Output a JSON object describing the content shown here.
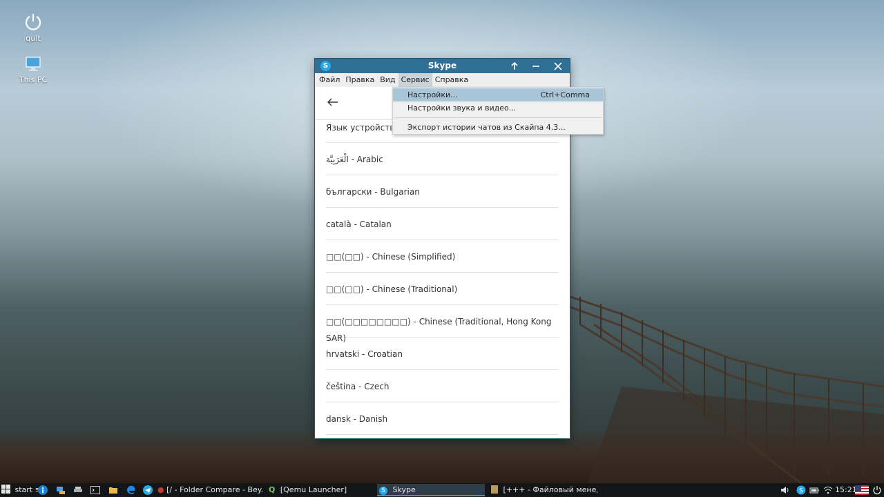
{
  "desktop": {
    "icons": [
      {
        "label": "quit",
        "icon": "power-icon"
      },
      {
        "label": "This PC",
        "icon": "computer-icon"
      }
    ]
  },
  "window": {
    "title": "Skype",
    "menu": [
      "Файл",
      "Правка",
      "Вид",
      "Сервис",
      "Справка"
    ],
    "active_menu": "Сервис",
    "list_header": "Язык устройства",
    "languages": [
      "الْعَرَبِيَّة - Arabic",
      "български - Bulgarian",
      "català - Catalan",
      "□□(□□) - Chinese (Simplified)",
      "□□(□□) - Chinese (Traditional)",
      "□□(□□□□□□□□) - Chinese (Traditional, Hong Kong SAR)",
      "hrvatski - Croatian",
      "čeština - Czech",
      "dansk - Danish"
    ]
  },
  "dropdown": {
    "items": [
      {
        "label": "Настройки...",
        "shortcut": "Ctrl+Comma",
        "highlighted": true
      },
      {
        "label": "Настройки звука и видео...",
        "shortcut": ""
      },
      {
        "label": "Экспорт истории чатов из Скайпа 4.3...",
        "shortcut": ""
      }
    ]
  },
  "taskbar": {
    "start_label": "start",
    "tasks": [
      {
        "label": "[/ - Folder Compare - Bey...",
        "icon": "beyond-compare-icon"
      },
      {
        "label": "[Qemu Launcher]",
        "icon": "qemu-icon"
      },
      {
        "label": "Skype",
        "icon": "skype-icon",
        "active": true
      },
      {
        "label": "[+++ - Файловый менедж...",
        "icon": "file-manager-icon"
      }
    ],
    "clock": "15:21",
    "colors": {
      "bar": "#141516",
      "active_task": "#2c3d49",
      "accent": "#4a90c2"
    }
  }
}
